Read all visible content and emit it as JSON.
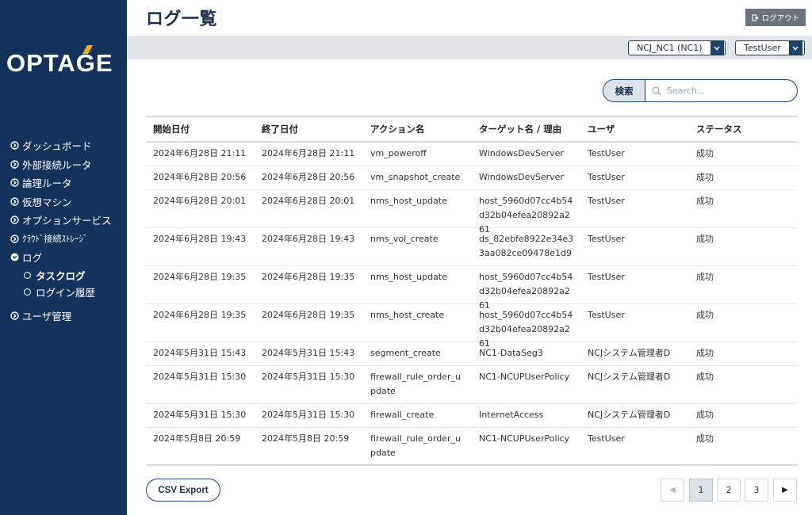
{
  "brand": {
    "logo_text": "OPTAGE"
  },
  "header": {
    "title": "ログ一覧",
    "logout_label": "ログアウト",
    "contract_select": "NCJ_NC1 (NC1)",
    "user_select": "TestUser"
  },
  "sidebar": {
    "items": [
      {
        "label": "ダッシュボード"
      },
      {
        "label": "外部接続ルータ"
      },
      {
        "label": "論理ルータ"
      },
      {
        "label": "仮想マシン"
      },
      {
        "label": "オプションサービス"
      },
      {
        "label": "ｸﾗｳﾄﾞ接続ｽﾄﾚｰｼﾞ"
      },
      {
        "label": "ログ"
      }
    ],
    "sub_items": [
      {
        "label": "タスクログ"
      },
      {
        "label": "ログイン履歴"
      }
    ],
    "bottom_item": {
      "label": "ユーザ管理"
    }
  },
  "search": {
    "button_label": "検索",
    "placeholder": "Search..."
  },
  "table": {
    "columns": [
      "開始日付",
      "終了日付",
      "アクション名",
      "ターゲット名 / 理由",
      "ユーザ",
      "ステータス"
    ],
    "rows": [
      [
        "2024年6月28日 21:11",
        "2024年6月28日 21:11",
        "vm_poweroff",
        "WindowsDevServer",
        "TestUser",
        "成功"
      ],
      [
        "2024年6月28日 20:56",
        "2024年6月28日 20:56",
        "vm_snapshot_create",
        "WindowsDevServer",
        "TestUser",
        "成功"
      ],
      [
        "2024年6月28日 20:01",
        "2024年6月28日 20:01",
        "nms_host_update",
        "host_5960d07cc4b54d32b04efea20892a261",
        "TestUser",
        "成功"
      ],
      [
        "2024年6月28日 19:43",
        "2024年6月28日 19:43",
        "nms_vol_create",
        "ds_82ebfe8922e34e33aa082ce09478e1d9",
        "TestUser",
        "成功"
      ],
      [
        "2024年6月28日 19:35",
        "2024年6月28日 19:35",
        "nms_host_update",
        "host_5960d07cc4b54d32b04efea20892a261",
        "TestUser",
        "成功"
      ],
      [
        "2024年6月28日 19:35",
        "2024年6月28日 19:35",
        "nms_host_create",
        "host_5960d07cc4b54d32b04efea20892a261",
        "TestUser",
        "成功"
      ],
      [
        "2024年5月31日 15:43",
        "2024年5月31日 15:43",
        "segment_create",
        "NC1-DataSeg3",
        "NCJシステム管理者D",
        "成功"
      ],
      [
        "2024年5月31日 15:30",
        "2024年5月31日 15:30",
        "firewall_rule_order_update",
        "NC1-NCUPUserPolicy",
        "NCJシステム管理者D",
        "成功"
      ],
      [
        "2024年5月31日 15:30",
        "2024年5月31日 15:30",
        "firewall_create",
        "InternetAccess",
        "NCJシステム管理者D",
        "成功"
      ],
      [
        "2024年5月8日 20:59",
        "2024年5月8日 20:59",
        "firewall_rule_order_update",
        "NC1-NCUPUserPolicy",
        "TestUser",
        "成功"
      ]
    ]
  },
  "footer": {
    "csv_label": "CSV Export",
    "pages": [
      "1",
      "2",
      "3"
    ],
    "current_page": "1",
    "prev_symbol": "◀",
    "next_symbol": "▶"
  }
}
